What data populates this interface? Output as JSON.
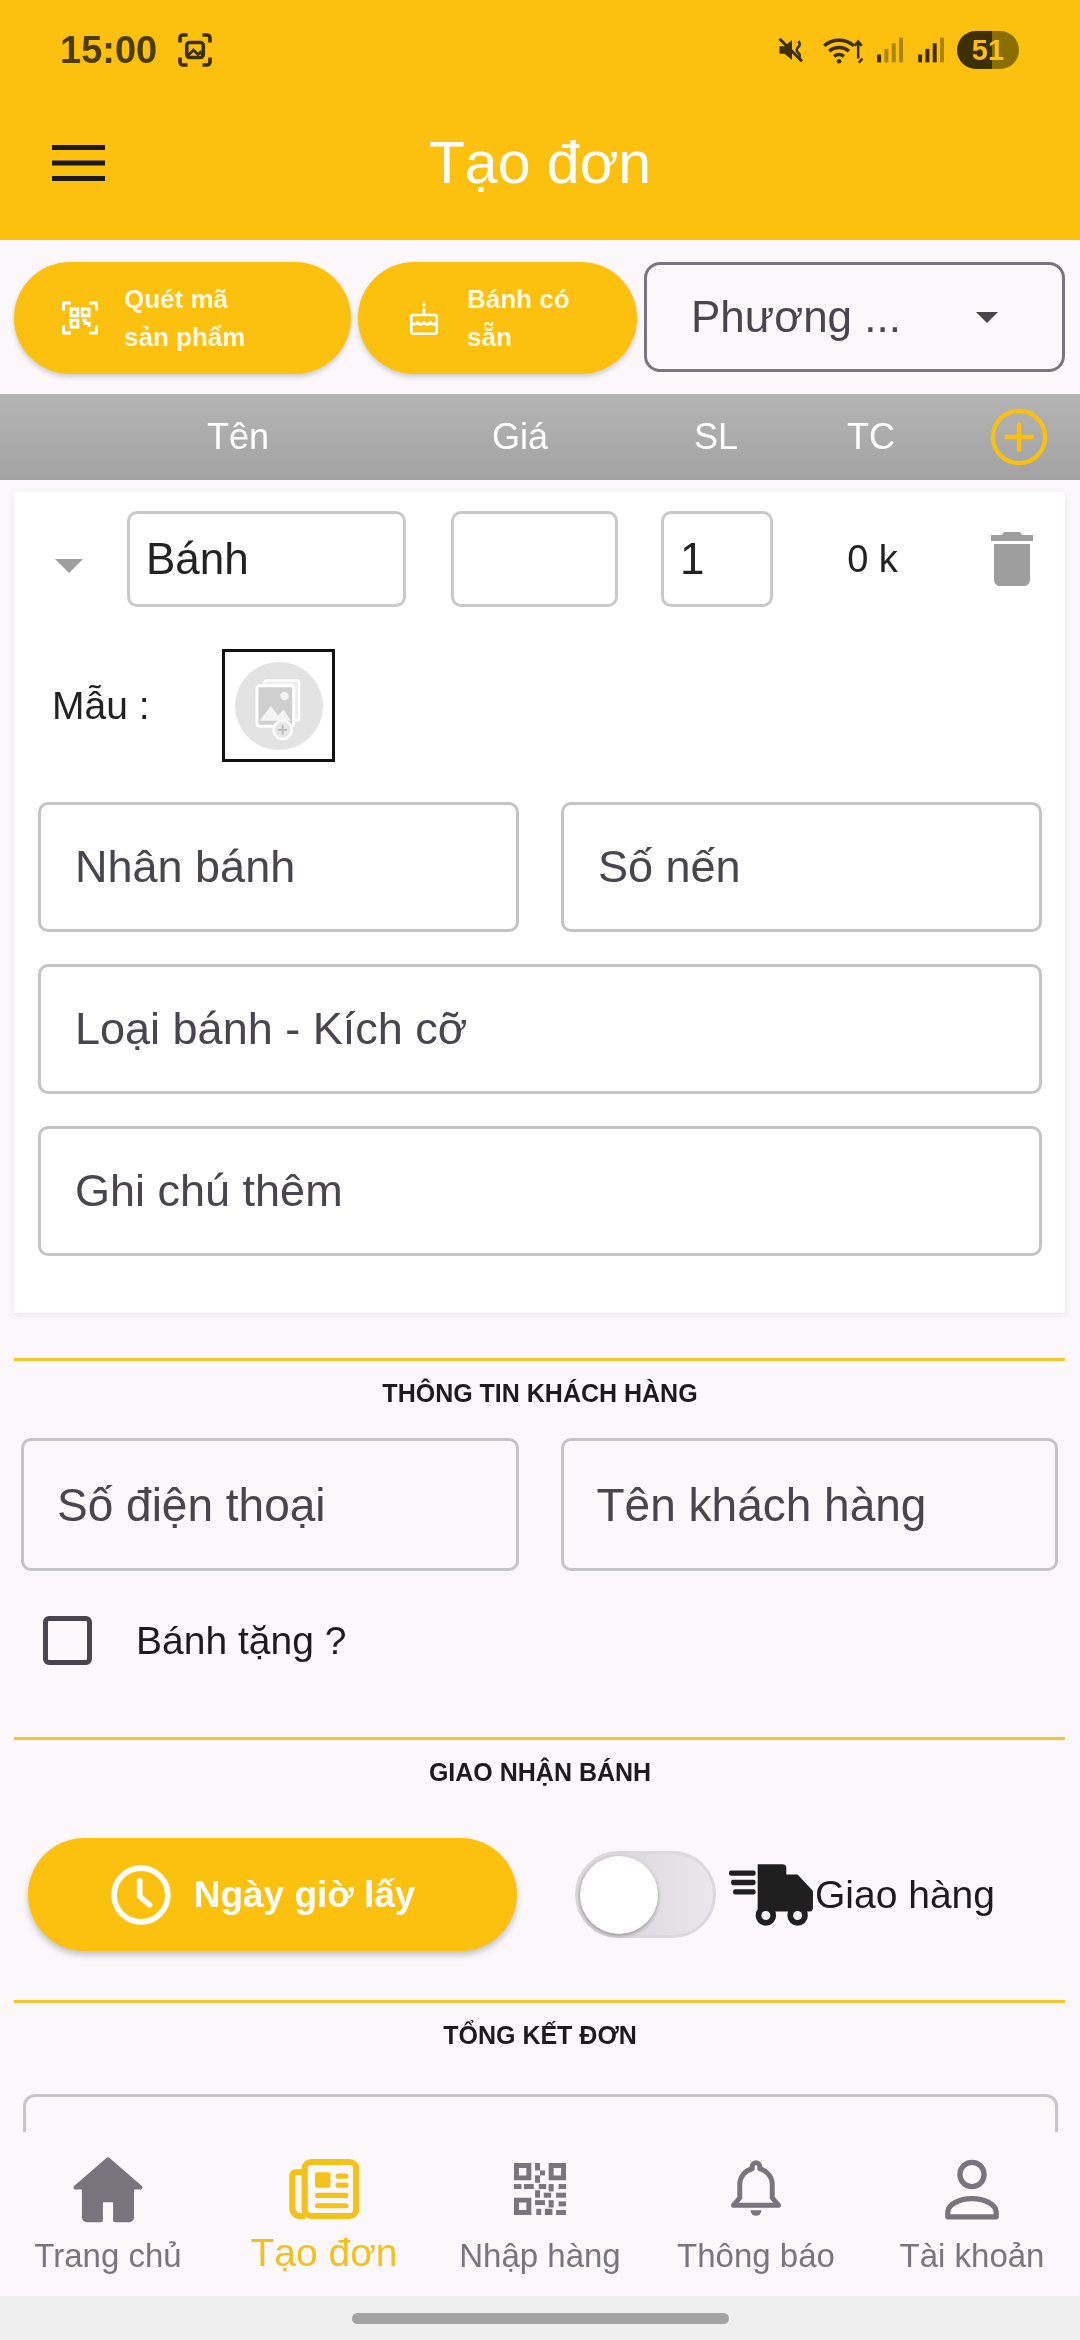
{
  "status_bar": {
    "time": "15:00",
    "battery": "51"
  },
  "app_bar": {
    "title": "Tạo đơn"
  },
  "actions": [
    {
      "kind": "scan",
      "label": "Quét mã sản phẩm"
    },
    {
      "kind": "cake",
      "label": "Bánh có sẵn"
    }
  ],
  "dropdown": {
    "value": "Phương ..."
  },
  "table": {
    "columns": [
      "Tên",
      "Giá",
      "SL",
      "TC"
    ]
  },
  "items": [
    {
      "name": "Bánh",
      "quantity": "1",
      "total": "0 k",
      "sample_label": "Mẫu :",
      "fields": [
        {
          "placeholder": "Nhân bánh"
        },
        {
          "placeholder": "Số nến"
        },
        {
          "placeholder": "Loại bánh - Kích cỡ"
        },
        {
          "placeholder": "Ghi chú thêm"
        }
      ]
    }
  ],
  "customer": {
    "title": "THÔNG TIN KHÁCH HÀNG",
    "fields": [
      {
        "placeholder": "Số điện thoại"
      },
      {
        "placeholder": "Tên khách hàng"
      }
    ],
    "gift": {
      "label": "Bánh tặng ?",
      "checked": false
    }
  },
  "delivery": {
    "title": "GIAO NHẬN BÁNH",
    "pickup_button": "Ngày giờ lấy",
    "delivery_toggle": {
      "label": "Giao hàng",
      "on": false
    }
  },
  "summary": {
    "title": "TỔNG KẾT ĐƠN"
  },
  "bottom_nav": [
    {
      "kind": "home",
      "label": "Trang chủ",
      "selected": false
    },
    {
      "kind": "order",
      "label": "Tạo đơn",
      "selected": true
    },
    {
      "kind": "qr",
      "label": "Nhập hàng",
      "selected": false
    },
    {
      "kind": "bell",
      "label": "Thông báo",
      "selected": false
    },
    {
      "kind": "person",
      "label": "Tài khoản",
      "selected": false
    }
  ]
}
